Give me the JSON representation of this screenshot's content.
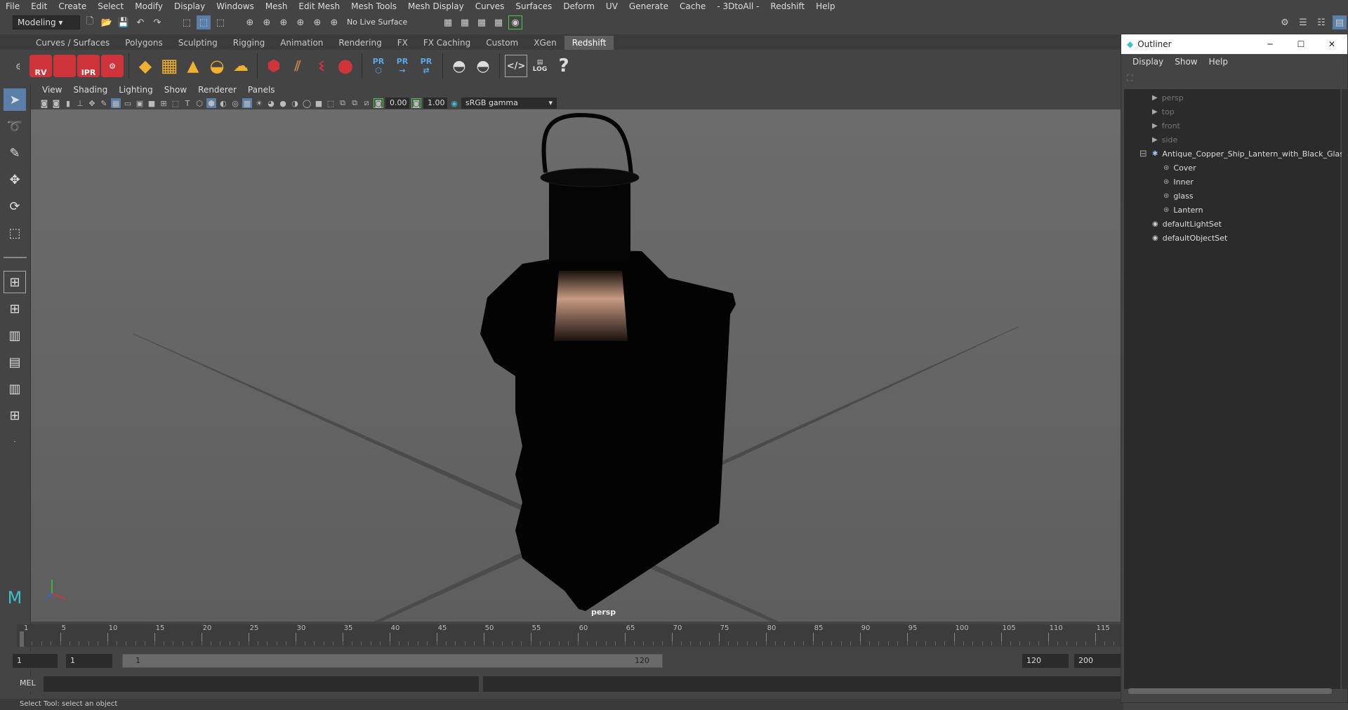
{
  "menubar": {
    "items": [
      "File",
      "Edit",
      "Create",
      "Select",
      "Modify",
      "Display",
      "Windows",
      "Mesh",
      "Edit Mesh",
      "Mesh Tools",
      "Mesh Display",
      "Curves",
      "Surfaces",
      "Deform",
      "UV",
      "Generate",
      "Cache",
      "- 3DtoAll -",
      "Redshift",
      "Help"
    ]
  },
  "toolbar": {
    "mode": "Modeling",
    "live_surface": "No Live Surface"
  },
  "shelf_tabs": {
    "items": [
      "Curves / Surfaces",
      "Polygons",
      "Sculpting",
      "Rigging",
      "Animation",
      "Rendering",
      "FX",
      "FX Caching",
      "Custom",
      "XGen",
      "Redshift"
    ],
    "active": "Redshift"
  },
  "shelf": {
    "rv": "RV",
    "ipr": "IPR",
    "pr": "PR",
    "log": "LOG",
    "help": "?"
  },
  "viewport": {
    "menu": [
      "View",
      "Shading",
      "Lighting",
      "Show",
      "Renderer",
      "Panels"
    ],
    "exposure": "0.00",
    "gamma": "1.00",
    "colorspace": "sRGB gamma",
    "camera_label": "persp"
  },
  "timeline": {
    "ticks": [
      "1",
      "5",
      "10",
      "15",
      "20",
      "25",
      "30",
      "35",
      "40",
      "45",
      "50",
      "55",
      "60",
      "65",
      "70",
      "75",
      "80",
      "85",
      "90",
      "95",
      "100",
      "105",
      "110",
      "115"
    ],
    "current": "1"
  },
  "range": {
    "start": "1",
    "current": "1",
    "slider_start": "1",
    "slider_end": "120",
    "end": "120",
    "max": "200"
  },
  "cmdline": {
    "label": "MEL"
  },
  "status": {
    "text": "Select Tool: select an object"
  },
  "outliner": {
    "title": "Outliner",
    "menu": [
      "Display",
      "Show",
      "Help"
    ],
    "items": [
      {
        "label": "persp",
        "dim": true,
        "indent": 1,
        "icon": "camera"
      },
      {
        "label": "top",
        "dim": true,
        "indent": 1,
        "icon": "camera"
      },
      {
        "label": "front",
        "dim": true,
        "indent": 1,
        "icon": "camera"
      },
      {
        "label": "side",
        "dim": true,
        "indent": 1,
        "icon": "camera"
      },
      {
        "label": "Antique_Copper_Ship_Lantern_with_Black_Glass",
        "dim": false,
        "indent": 1,
        "icon": "group"
      },
      {
        "label": "Cover",
        "dim": false,
        "indent": 2,
        "icon": "mesh"
      },
      {
        "label": "Inner",
        "dim": false,
        "indent": 2,
        "icon": "mesh"
      },
      {
        "label": "glass",
        "dim": false,
        "indent": 2,
        "icon": "mesh"
      },
      {
        "label": "Lantern",
        "dim": false,
        "indent": 2,
        "icon": "mesh"
      },
      {
        "label": "defaultLightSet",
        "dim": false,
        "indent": 1,
        "icon": "set"
      },
      {
        "label": "defaultObjectSet",
        "dim": false,
        "indent": 1,
        "icon": "set"
      }
    ]
  }
}
